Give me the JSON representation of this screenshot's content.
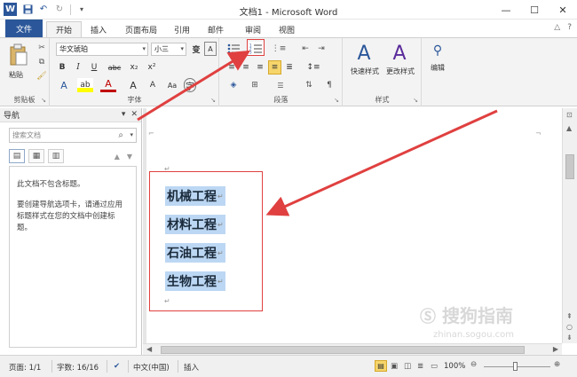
{
  "window": {
    "title": "文档1 - Microsoft Word",
    "logo": "W",
    "controls": [
      "—",
      "☐",
      "✕"
    ]
  },
  "tabs": {
    "file": "文件",
    "items": [
      "开始",
      "插入",
      "页面布局",
      "引用",
      "邮件",
      "审阅",
      "视图"
    ]
  },
  "ribbon": {
    "clipboard": {
      "label": "剪贴板",
      "paste": "粘贴"
    },
    "font": {
      "label": "字体",
      "font_name": "华文琥珀",
      "font_size": "小三",
      "wen": "wén",
      "phonetic": "变",
      "bold": "B",
      "italic": "I",
      "underline": "U",
      "strike": "abc",
      "subscript": "x₂",
      "superscript": "x²",
      "grow": "A",
      "shrink": "A",
      "clear": "Aa",
      "highlight": "ab",
      "color": "A",
      "char_a": "A",
      "enclosed": "字"
    },
    "paragraph": {
      "label": "段落"
    },
    "styles": {
      "label": "样式",
      "quick": "快速样式",
      "change": "更改样式"
    },
    "editing": {
      "label": "编辑"
    }
  },
  "nav": {
    "title": "导航",
    "search_placeholder": "搜索文档",
    "no_headings": "此文档不包含标题。",
    "hint": "要创建导航选项卡，请通过应用标题样式在您的文档中创建标题。"
  },
  "document": {
    "lines": [
      "机械工程",
      "材料工程",
      "石油工程",
      "生物工程"
    ],
    "mark": "↵"
  },
  "status": {
    "page": "页面: 1/1",
    "words": "字数: 16/16",
    "lang": "中文(中国)",
    "insert": "插入",
    "zoom": "100%"
  },
  "watermark": {
    "brand": "搜狗指南",
    "url": "zhinan.sogou.com"
  },
  "colors": {
    "accent": "#2b579a",
    "annotation": "#e04040",
    "selection": "#bcd7f3"
  }
}
